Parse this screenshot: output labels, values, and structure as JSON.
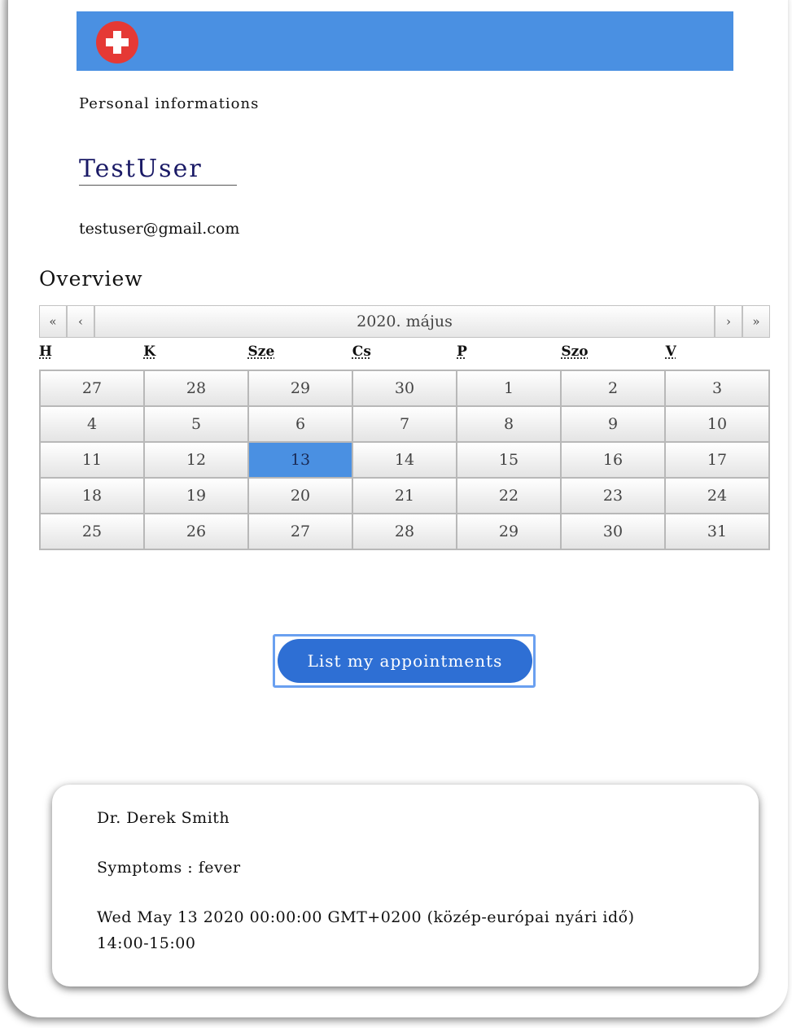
{
  "header": {
    "logo_icon": "medical-cross-icon",
    "bar_color": "#4a90e2"
  },
  "personal": {
    "title": "Personal informations",
    "username": "TestUser",
    "email": "testuser@gmail.com"
  },
  "overview": {
    "title": "Overview",
    "calendar": {
      "nav": {
        "prev_year": "«",
        "prev_month": "‹",
        "label": "2020. május",
        "next_month": "›",
        "next_year": "»"
      },
      "weekdays": [
        "H",
        "K",
        "Sze",
        "Cs",
        "P",
        "Szo",
        "V"
      ],
      "days": [
        "27",
        "28",
        "29",
        "30",
        "1",
        "2",
        "3",
        "4",
        "5",
        "6",
        "7",
        "8",
        "9",
        "10",
        "11",
        "12",
        "13",
        "14",
        "15",
        "16",
        "17",
        "18",
        "19",
        "20",
        "21",
        "22",
        "23",
        "24",
        "25",
        "26",
        "27",
        "28",
        "29",
        "30",
        "31"
      ],
      "selected_day": "13",
      "selected_color": "#4a90e2"
    }
  },
  "actions": {
    "list_appointments": "List my appointments"
  },
  "appointment": {
    "doctor": "Dr. Derek Smith",
    "symptoms": "Symptoms : fever",
    "date": "Wed May 13 2020 00:00:00 GMT+0200 (közép-európai nyári idő)",
    "time": "14:00-15:00"
  }
}
